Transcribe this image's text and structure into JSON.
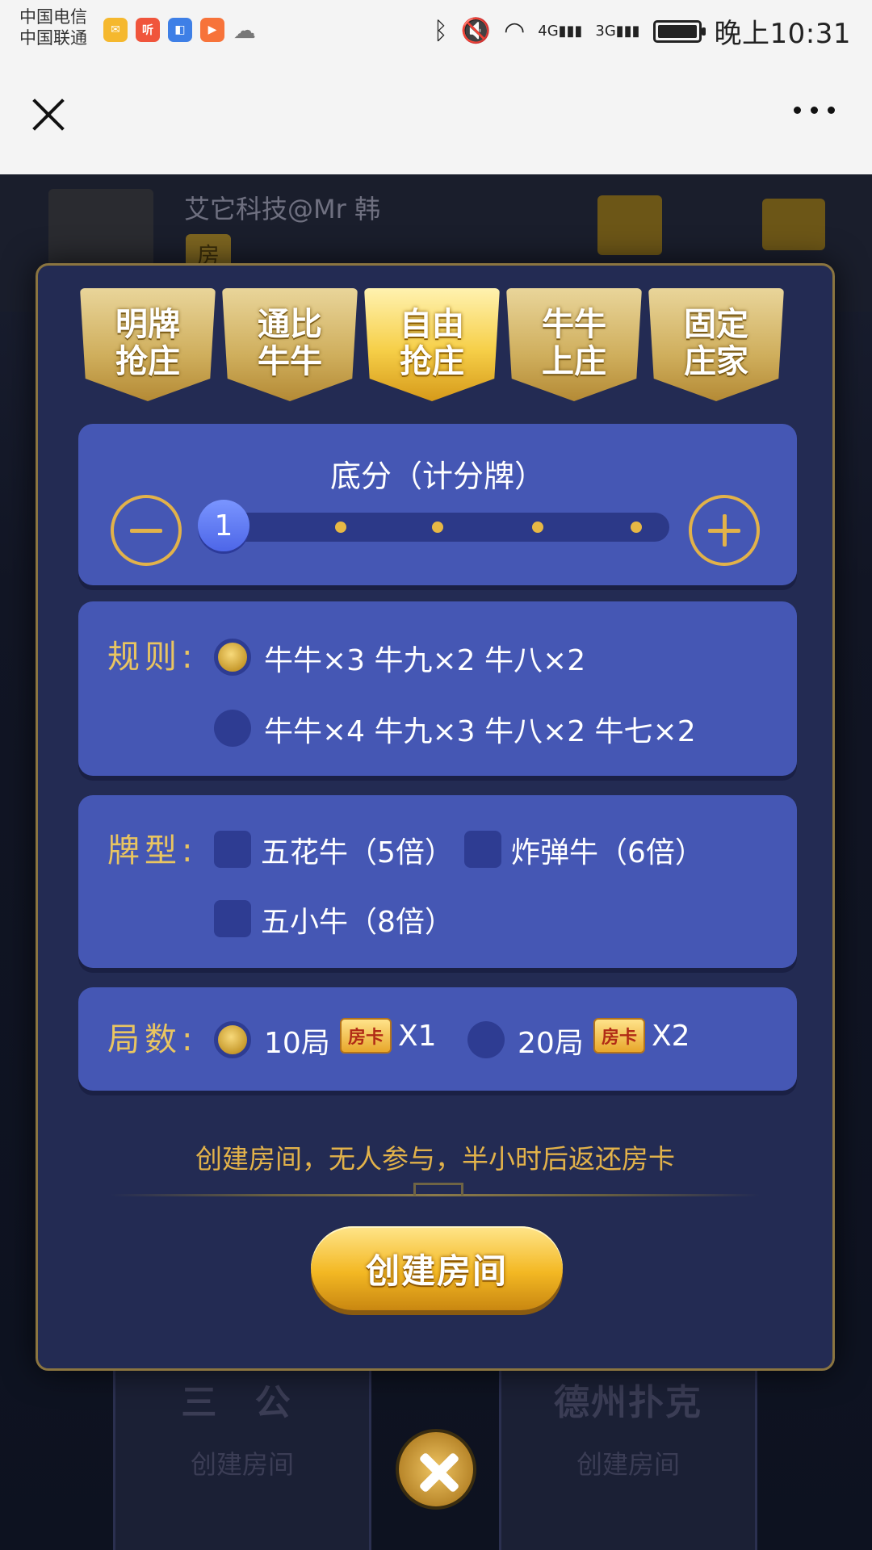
{
  "status_bar": {
    "carrier_1": "中国电信",
    "carrier_2": "中国联通",
    "notification_icons": [
      "mail-icon",
      "ting-app-icon",
      "app-icon",
      "video-icon",
      "cloud-icon"
    ],
    "ting_label": "听",
    "time": "晚上10:31",
    "net_1": "4G",
    "net_2": "3G"
  },
  "title_bar": {
    "close_icon": "close-icon",
    "more_icon": "more-icon"
  },
  "game_header": {
    "username": "艾它科技@Mr 韩",
    "room_tag": "房"
  },
  "tabs": [
    {
      "line1": "明牌",
      "line2": "抢庄",
      "active": false
    },
    {
      "line1": "通比",
      "line2": "牛牛",
      "active": false
    },
    {
      "line1": "自由",
      "line2": "抢庄",
      "active": true
    },
    {
      "line1": "牛牛",
      "line2": "上庄",
      "active": false
    },
    {
      "line1": "固定",
      "line2": "庄家",
      "active": false
    }
  ],
  "base_score": {
    "title": "底分（计分牌）",
    "value": "1",
    "steps": 5,
    "selected_index": 0
  },
  "rules": {
    "label": "规则:",
    "options": [
      {
        "text": "牛牛×3 牛九×2 牛八×2",
        "selected": true
      },
      {
        "text": "牛牛×4 牛九×3 牛八×2 牛七×2",
        "selected": false
      }
    ]
  },
  "card_types": {
    "label": "牌型:",
    "options": [
      {
        "text": "五花牛（5倍）",
        "checked": false
      },
      {
        "text": "炸弹牛（6倍）",
        "checked": false
      },
      {
        "text": "五小牛（8倍）",
        "checked": false
      }
    ]
  },
  "rounds": {
    "label": "局数:",
    "options": [
      {
        "text": "10局",
        "card_label": "房卡",
        "cost": "X1",
        "selected": true
      },
      {
        "text": "20局",
        "card_label": "房卡",
        "cost": "X2",
        "selected": false
      }
    ]
  },
  "notice": "创建房间，无人参与，半小时后返还房卡",
  "create_button": "创建房间",
  "background_cards": [
    {
      "title": "三 公",
      "cta": "创建房间"
    },
    {
      "title": "德州扑克",
      "cta": "创建房间"
    }
  ],
  "colors": {
    "accent_gold": "#e2b24a",
    "panel_blue": "#4557b4",
    "dialog_bg": "#232b53"
  }
}
